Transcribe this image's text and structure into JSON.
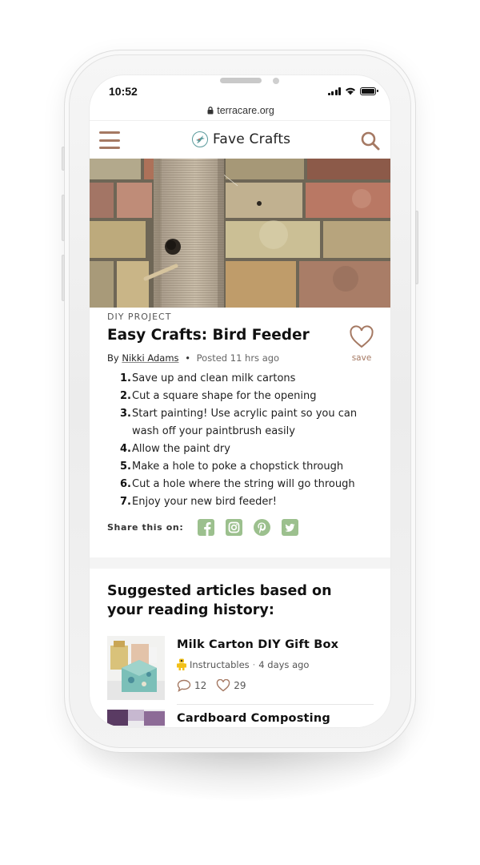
{
  "status_bar": {
    "time": "10:52"
  },
  "browser": {
    "url": "terracare.org"
  },
  "header": {
    "brand_name": "Fave Crafts",
    "menu_icon": "hamburger-icon",
    "search_icon": "search-icon"
  },
  "colors": {
    "accent": "#a57963",
    "social": "#9cc08e",
    "logo": "#5b9b9c"
  },
  "article": {
    "category": "DIY PROJECT",
    "title": "Easy Crafts: Bird Feeder",
    "by_label": "By",
    "author": "Nikki Adams",
    "separator": "•",
    "posted": "Posted 11 hrs ago",
    "save_label": "save",
    "steps": [
      "Save up and clean milk cartons",
      "Cut a square shape for the opening",
      "Start painting! Use acrylic paint so you can wash off your paintbrush easily",
      "Allow the paint dry",
      "Make a hole to poke a chopstick through",
      "Cut a hole where the string will go through",
      "Enjoy your new bird feeder!"
    ],
    "share_label": "Share this on:",
    "share_icons": [
      "facebook-icon",
      "instagram-icon",
      "pinterest-icon",
      "twitter-icon"
    ]
  },
  "suggested": {
    "heading": "Suggested articles based on your reading history:",
    "items": [
      {
        "title": "Milk Carton DIY Gift Box",
        "source": "Instructables",
        "separator": "·",
        "age": "4 days ago",
        "comments": "12",
        "likes": "29"
      },
      {
        "title": "Cardboard Composting"
      }
    ]
  }
}
